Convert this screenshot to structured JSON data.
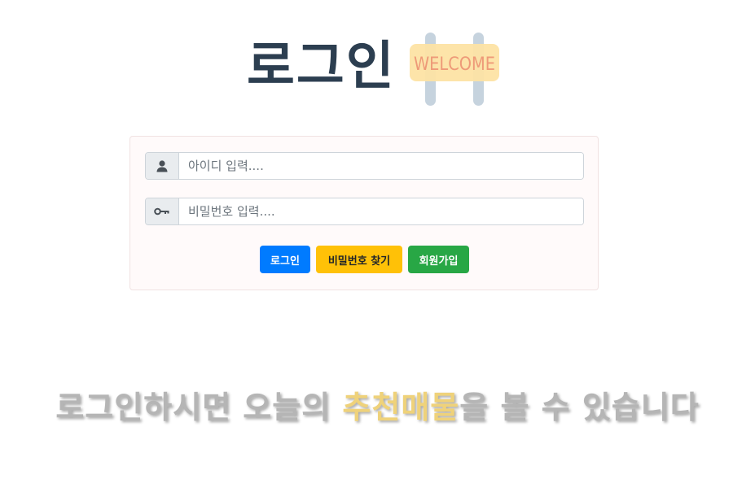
{
  "header": {
    "title": "로그인",
    "welcome_sign_text": "WELCOME"
  },
  "form": {
    "id_placeholder": "아이디 입력....",
    "pw_placeholder": "비밀번호 입력....",
    "id_icon": "user-icon",
    "pw_icon": "key-icon"
  },
  "buttons": {
    "login": "로그인",
    "find_password": "비밀번호 찾기",
    "signup": "회원가입"
  },
  "promo": {
    "before": "로그인하시면 오늘의 ",
    "highlight": "추천매물",
    "after": "을 볼 수 있습니다"
  },
  "colors": {
    "title": "#2c3e50",
    "login_button": "#007bff",
    "find_button": "#ffc107",
    "signup_button": "#28a745",
    "promo_gray": "#b5b5b5",
    "promo_gold": "#efd27a"
  }
}
